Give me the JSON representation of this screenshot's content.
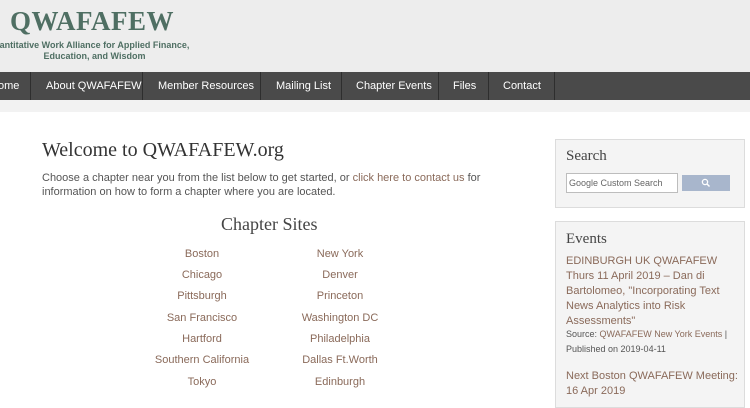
{
  "header": {
    "title": "QWAFAFEW",
    "subtitle_line1": "antitative Work Alliance for Applied Finance,",
    "subtitle_line2": "Education, and Wisdom"
  },
  "nav": {
    "items": [
      "ome",
      "About QWAFAFEW",
      "Member Resources",
      "Mailing List",
      "Chapter Events",
      "Files",
      "Contact"
    ]
  },
  "main": {
    "title": "Welcome to QWAFAFEW.org",
    "intro_before": "Choose a chapter near you from the list below to get started, or ",
    "intro_link": "click here to contact us",
    "intro_after": " for information on how to form a chapter where you are located.",
    "chapters_title": "Chapter Sites",
    "chapters_left": [
      "Boston",
      "Chicago",
      "Pittsburgh",
      "San Francisco",
      "Hartford",
      "Southern California",
      "Tokyo"
    ],
    "chapters_right": [
      "New York",
      "Denver",
      "Princeton",
      "Washington DC",
      "Philadelphia",
      "Dallas Ft.Worth",
      "Edinburgh"
    ]
  },
  "sidebar": {
    "search": {
      "title": "Search",
      "placeholder": "Google Custom Search"
    },
    "events": {
      "title": "Events",
      "items": [
        {
          "link": "EDINBURGH UK QWAFAFEW Thurs 11 April 2019 – Dan di Bartolomeo, \"Incorporating Text News Analytics into Risk Assessments\"",
          "source_label": "Source: ",
          "source_link": "QWAFAFEW New York Events",
          "published": " | Published on 2019-04-11"
        },
        {
          "link": "Next Boston QWAFAFEW Meeting: 16 Apr 2019"
        }
      ]
    }
  },
  "colors": {
    "accent": "#4f6f63",
    "link": "#8a6a5a",
    "nav_bg": "#4a4a4a",
    "header_bg": "#ededed"
  }
}
